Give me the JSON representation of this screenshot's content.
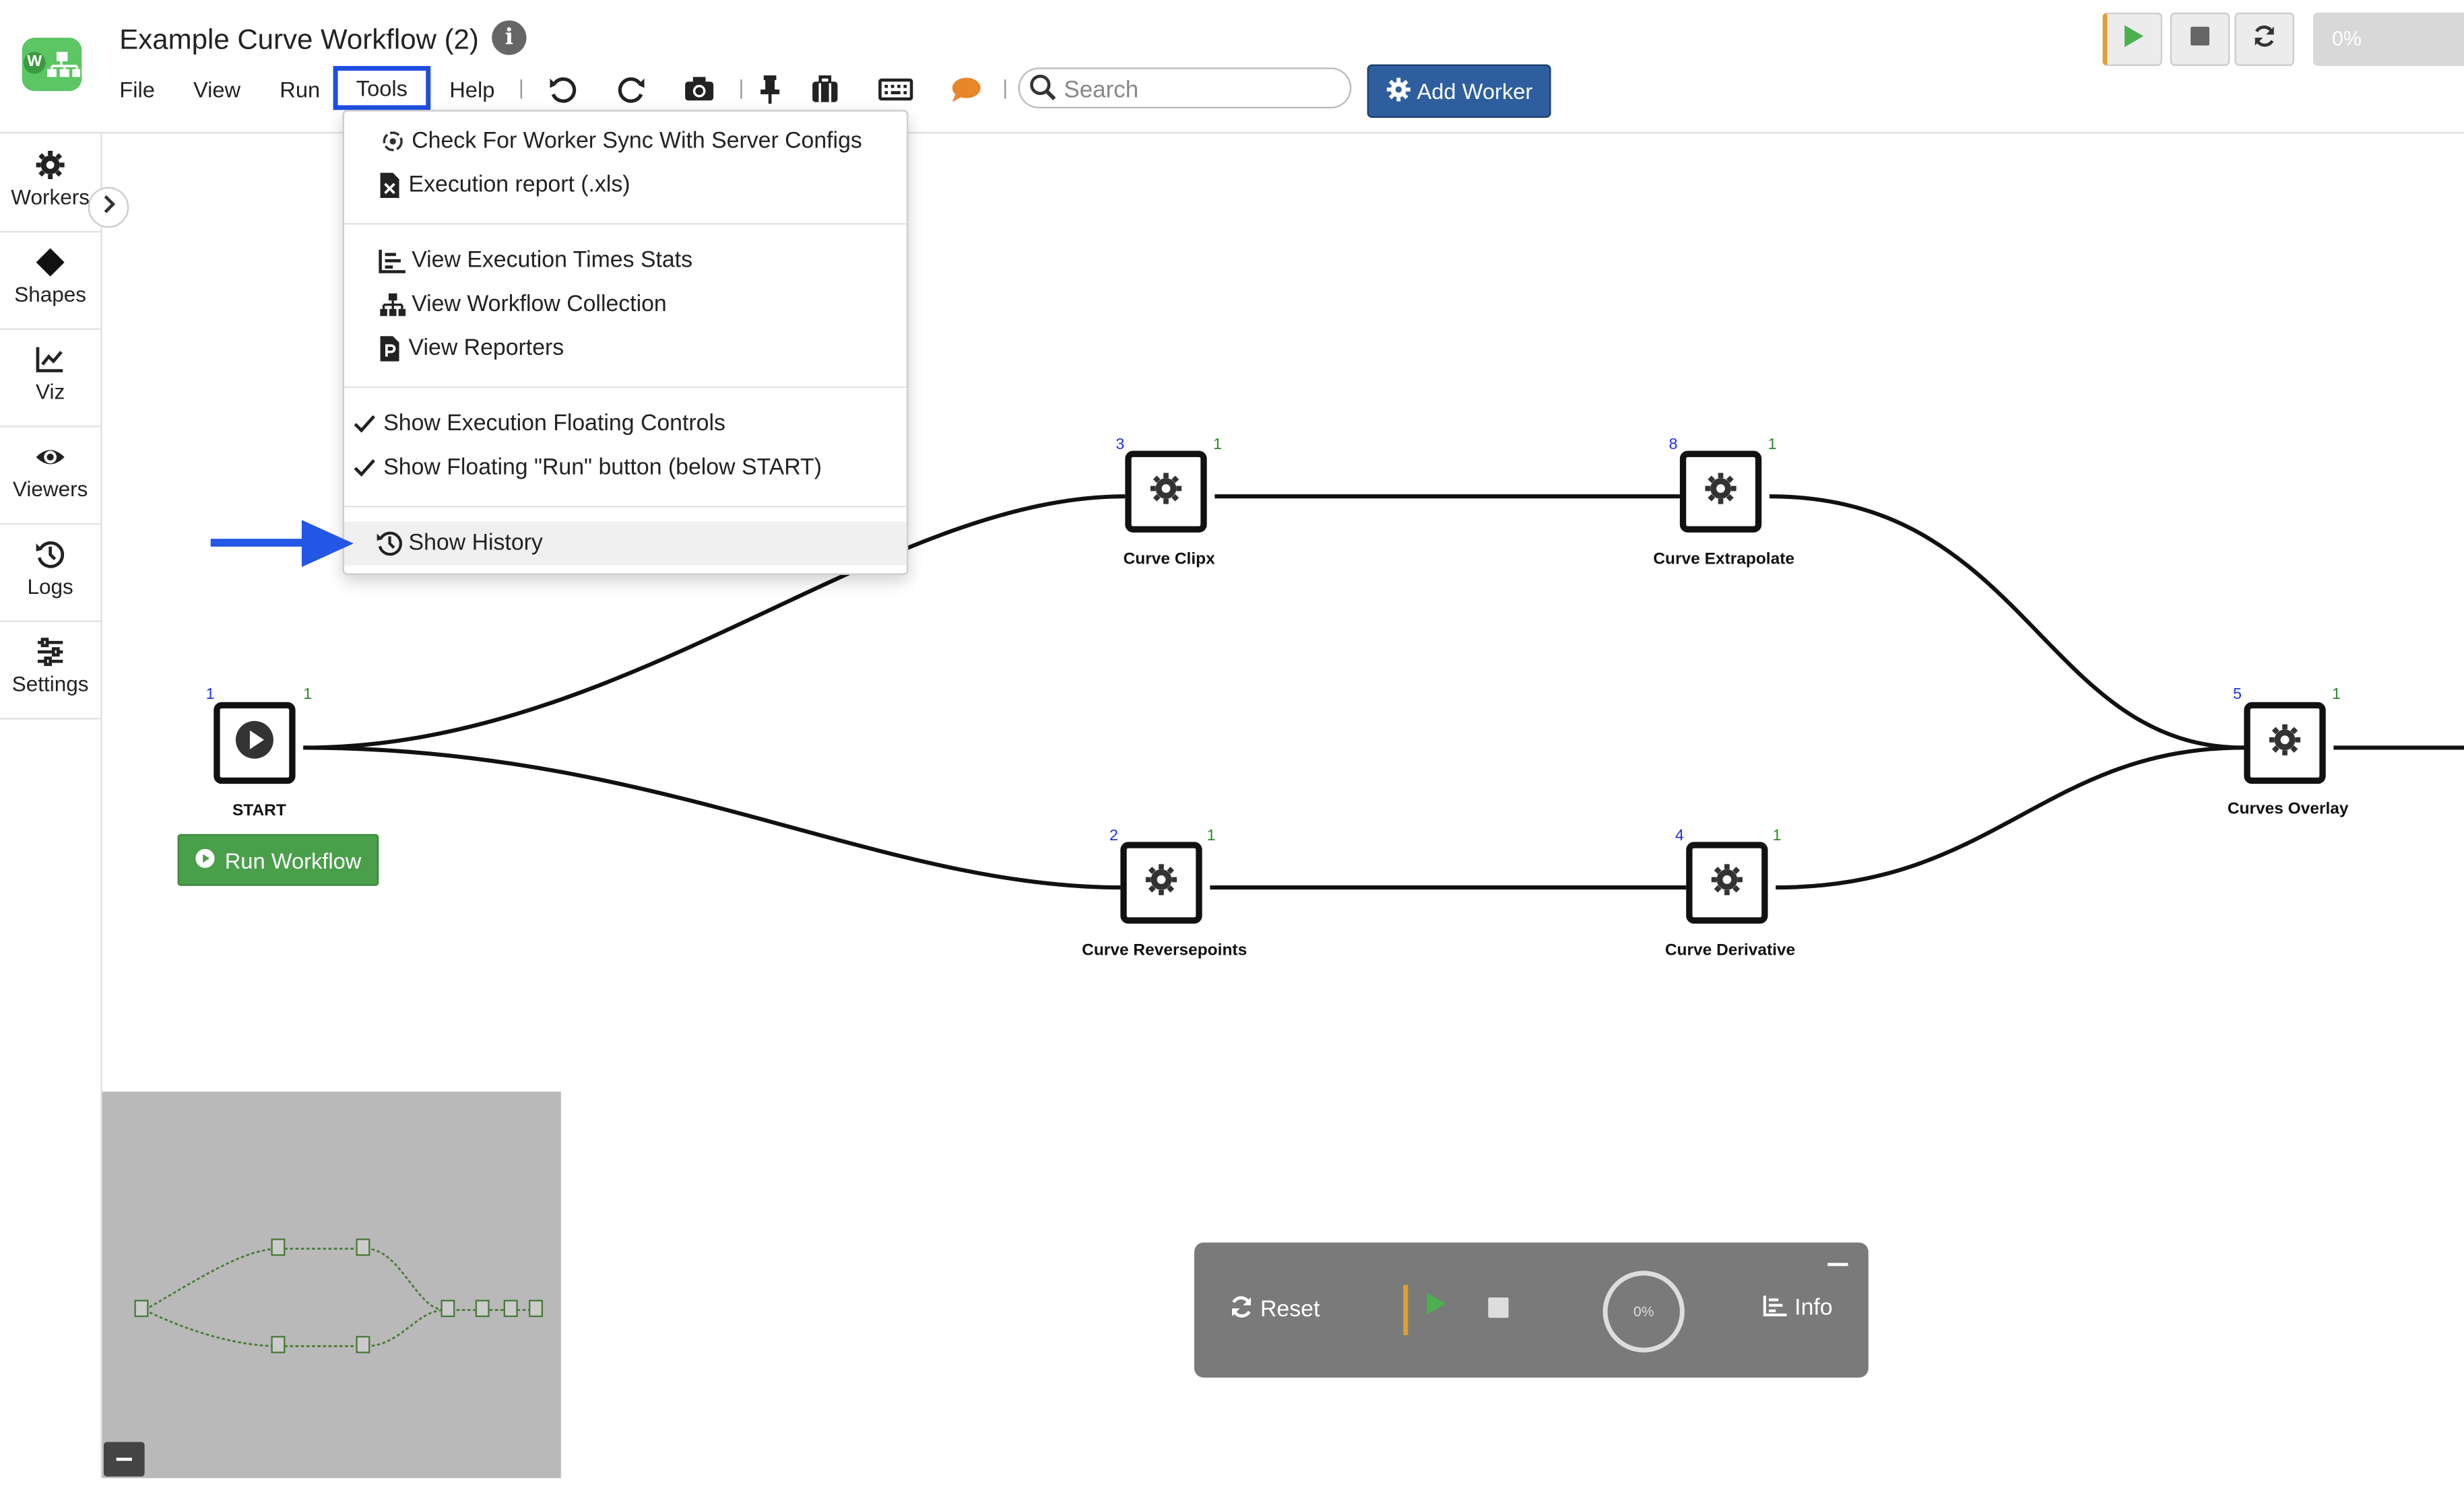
{
  "app": {
    "title": "Example Curve Workflow (2)",
    "logo_letter": "W",
    "accent_color": "#2e5e9e",
    "highlight_color": "#1f4fe0"
  },
  "menubar": {
    "file": "File",
    "view": "View",
    "run": "Run",
    "tools": "Tools",
    "help": "Help"
  },
  "toolbar": {
    "icons": [
      "undo-icon",
      "redo-icon",
      "camera-icon",
      "pin-icon",
      "clipboard-icon",
      "keyboard-icon",
      "comment-icon"
    ],
    "separator": "|",
    "search_placeholder": "Search",
    "add_worker_label": "Add Worker"
  },
  "top_right": {
    "progress_label": "0%"
  },
  "sidebar": {
    "items": [
      {
        "label": "Workers",
        "icon": "gear-icon"
      },
      {
        "label": "Shapes",
        "icon": "diamond-icon"
      },
      {
        "label": "Viz",
        "icon": "chart-line-icon"
      },
      {
        "label": "Viewers",
        "icon": "eye-icon"
      },
      {
        "label": "Logs",
        "icon": "history-icon"
      },
      {
        "label": "Settings",
        "icon": "sliders-icon"
      }
    ]
  },
  "tools_menu": {
    "items": [
      {
        "label": "Check For Worker Sync With Server Configs",
        "icon": "sync-icon"
      },
      {
        "label": "Execution report (.xls)",
        "icon": "excel-file-icon"
      },
      {
        "label": "View Execution Times Stats",
        "icon": "bar-chart-icon"
      },
      {
        "label": "View Workflow Collection",
        "icon": "sitemap-icon"
      },
      {
        "label": "View Reporters",
        "icon": "p-file-icon"
      },
      {
        "label": "Show Execution Floating Controls",
        "icon": "check-icon"
      },
      {
        "label": "Show Floating \"Run\" button (below START)",
        "icon": "check-icon"
      },
      {
        "label": "Show History",
        "icon": "history-icon"
      }
    ]
  },
  "workflow": {
    "nodes": [
      {
        "name": "START",
        "in": "1",
        "out": "1",
        "icon": "play-icon"
      },
      {
        "name": "Curve Clipx",
        "in": "3",
        "out": "1",
        "icon": "gear-icon"
      },
      {
        "name": "Curve Extrapolate",
        "in": "8",
        "out": "1",
        "icon": "gear-icon"
      },
      {
        "name": "Curve Reversepoints",
        "in": "2",
        "out": "1",
        "icon": "gear-icon"
      },
      {
        "name": "Curve Derivative",
        "in": "4",
        "out": "1",
        "icon": "gear-icon"
      },
      {
        "name": "Curves Overlay",
        "in": "5",
        "out": "1",
        "icon": "gear-icon"
      }
    ],
    "run_workflow_label": "Run Workflow"
  },
  "floating_controls": {
    "reset_label": "Reset",
    "progress_label": "0%",
    "info_label": "Info"
  }
}
